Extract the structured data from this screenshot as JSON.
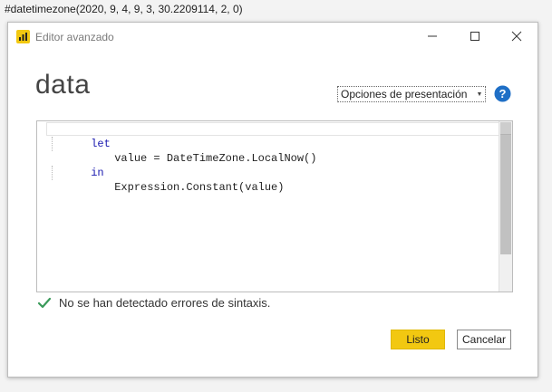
{
  "top_expression": "#datetimezone(2020, 9, 4, 9, 3, 30.2209114, 2, 0)",
  "dialog": {
    "title": "Editor avanzado",
    "query_name": "data",
    "display_options_label": "Opciones de presentación",
    "accent_color": "#f2c811"
  },
  "editor": {
    "lines": [
      {
        "keyword": "let",
        "text": ""
      },
      {
        "keyword": "",
        "text": "value = DateTimeZone.LocalNow()"
      },
      {
        "keyword": "in",
        "text": ""
      },
      {
        "keyword": "",
        "text": "Expression.Constant(value)"
      }
    ]
  },
  "status": {
    "message": "No se han detectado errores de sintaxis.",
    "icon": "checkmark-icon",
    "icon_color": "#3a9a5a"
  },
  "buttons": {
    "ok_label": "Listo",
    "cancel_label": "Cancelar"
  }
}
